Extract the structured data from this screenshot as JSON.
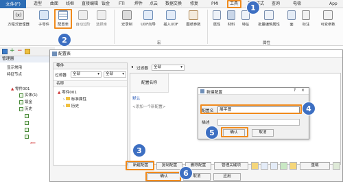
{
  "menubar": {
    "file": "文件(F)",
    "items": [
      "造型",
      "曲面",
      "线框",
      "直接编辑",
      "钣金",
      "FTI",
      "焊件",
      "点云",
      "数据交换",
      "修复",
      "PMI",
      "工具",
      "视觉样式",
      "查询",
      "电极",
      "App"
    ]
  },
  "ribbon": {
    "buttons": [
      "方程式管理器",
      "子零件",
      "配置表",
      "自动过阶",
      "选择库",
      "宏录制",
      "UDF向导",
      "插入UDF",
      "图纸参数",
      "属性",
      "材料",
      "特征",
      "批量编辑属性",
      "面",
      "标注",
      "可变参数"
    ],
    "groups": [
      "宏",
      "属性"
    ]
  },
  "left": {
    "title": "管理器",
    "items": [
      "显示常用",
      "特征节点",
      "零件001",
      "实体(1)",
      "钣金",
      "历史"
    ]
  },
  "dialog": {
    "title": "配置表",
    "part_tab": "零件",
    "filter_label": "过滤器",
    "filter_value": "全部",
    "filter_value2": "全部",
    "name_col": "名称",
    "tree": [
      "零件001",
      "标准属性",
      "历史"
    ],
    "filter_label_right": "过滤器",
    "filter_value_right": "全部",
    "config_name_col": "配置名称",
    "default_row": "默认",
    "add_row": "<添加一个新配置>",
    "buttons": [
      "新建配置",
      "复制配置",
      "删除配置",
      "管理关键项"
    ],
    "refresh": "重载",
    "ok": "确认",
    "cancel": "取消",
    "apply": "应用"
  },
  "newcfg": {
    "title": "新建配置",
    "name_label": "配置名",
    "name_value": "展平图",
    "desc_label": "描述",
    "ok": "确认",
    "cancel": "取消"
  },
  "badges": [
    "1",
    "2",
    "3",
    "4",
    "5",
    "6"
  ],
  "colors": {
    "accent": "#f08a1c",
    "badge": "#3d6fc2",
    "file": "#2d6db5"
  }
}
